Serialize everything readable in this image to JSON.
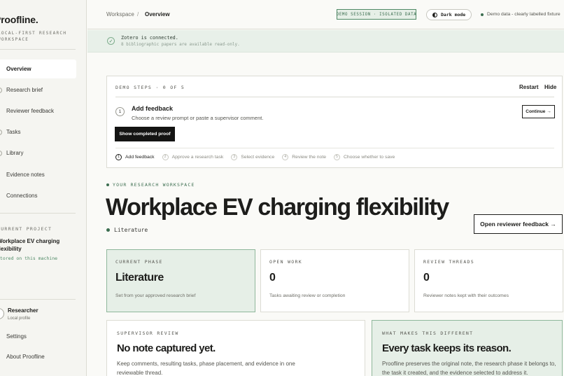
{
  "sidebar": {
    "brand": "Proofline.",
    "tagline": "LOCAL-FIRST RESEARCH WORKSPACE",
    "nav": [
      {
        "label": "Overview",
        "active": true
      },
      {
        "label": "Research brief"
      },
      {
        "label": "Reviewer feedback"
      },
      {
        "label": "Tasks"
      },
      {
        "label": "Library"
      },
      {
        "label": "Evidence notes"
      },
      {
        "label": "Connections"
      }
    ],
    "project_label": "CURRENT PROJECT",
    "project_title": "Workplace EV charging flexibility",
    "project_store": "Stored on this machine",
    "user_name": "Researcher",
    "user_sub": "Local profile",
    "settings": "Settings",
    "about": "About Proofline"
  },
  "topbar": {
    "crumb_root": "Workspace",
    "crumb_sep": "/",
    "crumb_current": "Overview",
    "demo_badge": "DEMO SESSION · ISOLATED DATA",
    "dark_mode": "Dark mode",
    "demo_note": "Demo data - clearly labelled fixture"
  },
  "banner": {
    "title": "Zotero is connected.",
    "sub": "8 bibliographic papers are available read-only."
  },
  "steps": {
    "label": "DEMO STEPS · 0 OF 5",
    "restart": "Restart",
    "hide": "Hide",
    "current_num": "1",
    "current_title": "Add feedback",
    "current_desc": "Choose a review prompt or paste a supervisor comment.",
    "proof_button": "Show completed proof",
    "continue_button": "Continue →",
    "items": [
      {
        "num": "1",
        "label": "Add feedback"
      },
      {
        "num": "2",
        "label": "Approve a research task"
      },
      {
        "num": "3",
        "label": "Select evidence"
      },
      {
        "num": "4",
        "label": "Review the note"
      },
      {
        "num": "5",
        "label": "Choose whether to save"
      }
    ]
  },
  "hero": {
    "eyebrow": "YOUR RESEARCH WORKSPACE",
    "title": "Workplace EV charging flexibility",
    "phase": "Literature",
    "open_feedback": "Open reviewer feedback →"
  },
  "stats": [
    {
      "label": "CURRENT PHASE",
      "value": "Literature",
      "desc": "Set from your approved research brief"
    },
    {
      "label": "OPEN WORK",
      "value": "0",
      "desc": "Tasks awaiting review or completion"
    },
    {
      "label": "REVIEW THREADS",
      "value": "0",
      "desc": "Reviewer notes kept with their outcomes"
    }
  ],
  "cards": {
    "supervisor": {
      "label": "SUPERVISOR REVIEW",
      "title": "No note captured yet.",
      "body": "Keep comments, resulting tasks, phase placement, and evidence in one reviewable thread."
    },
    "different": {
      "label": "WHAT MAKES THIS DIFFERENT",
      "title": "Every task keeps its reason.",
      "body": "Proofline preserves the original note, the research phase it belongs to, the task it created, and the evidence selected to address it."
    }
  },
  "colors": {
    "accent_green": "#3c6e50",
    "green_tint": "#e6efe7",
    "ink": "#1d1d1b"
  }
}
